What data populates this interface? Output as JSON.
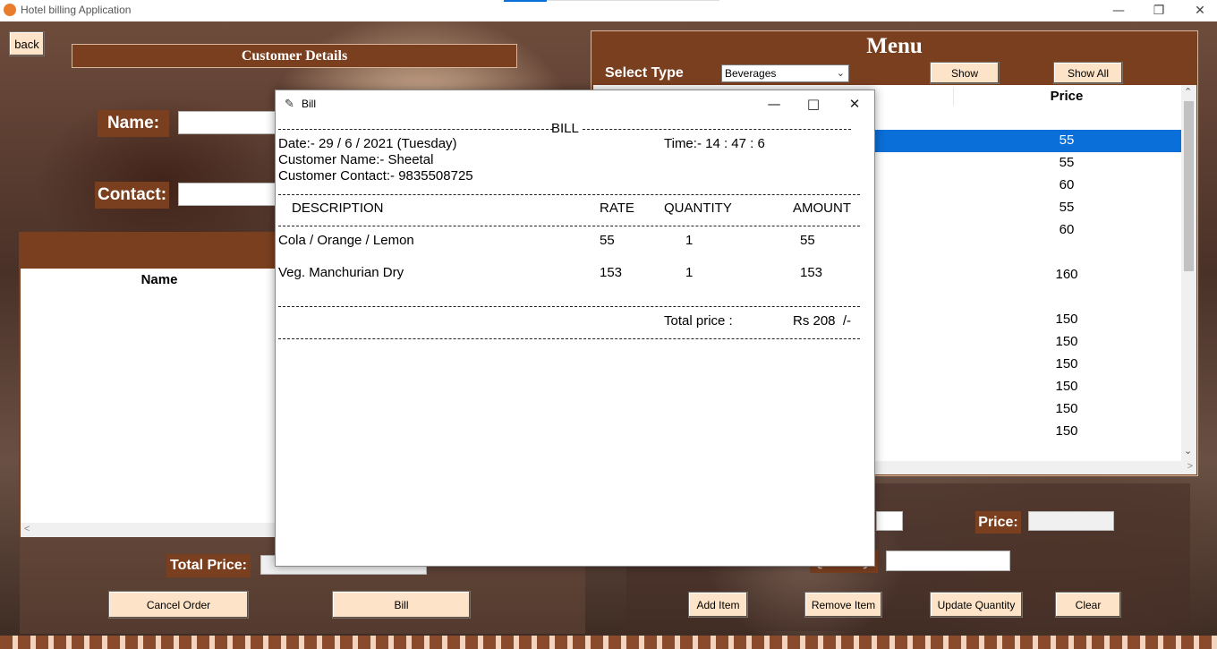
{
  "window": {
    "title": "Hotel billing Application",
    "minimize": "—",
    "restore": "❐",
    "close": "✕"
  },
  "left": {
    "back_label": "back",
    "customer_details_title": "Customer Details",
    "name_label": "Name:",
    "contact_label": "Contact:",
    "order_list_header": "Name",
    "total_price_label": "Total Price:",
    "cancel_label": "Cancel Order",
    "bill_label": "Bill"
  },
  "menu": {
    "title": "Menu",
    "select_type_label": "Select Type",
    "select_value": "Beverages",
    "show_label": "Show",
    "show_all_label": "Show All",
    "price_header": "Price",
    "prices": [
      "55",
      "55",
      "60",
      "55",
      "60",
      "160",
      "150",
      "150",
      "150",
      "150",
      "150",
      "150"
    ],
    "selected_index": 0
  },
  "item": {
    "price_label": "Price:",
    "quantity_label": "Quantity:",
    "add_label": "Add Item",
    "remove_label": "Remove Item",
    "update_label": "Update Quantity",
    "clear_label": "Clear"
  },
  "bill": {
    "title": "Bill",
    "heading": "BILL",
    "date": "Date:- 29 / 6 / 2021 (Tuesday)",
    "time": "Time:- 14 : 47 : 6",
    "customer_name": "Customer Name:- Sheetal",
    "customer_contact": "Customer Contact:- 9835508725",
    "columns": [
      "DESCRIPTION",
      "RATE",
      "QUANTITY",
      "AMOUNT"
    ],
    "rows": [
      {
        "description": "Cola / Orange / Lemon",
        "rate": "55",
        "quantity": "1",
        "amount": "55"
      },
      {
        "description": "Veg. Manchurian Dry",
        "rate": "153",
        "quantity": "1",
        "amount": "153"
      }
    ],
    "total_label": "Total price :",
    "total_value": "Rs 208  /-"
  }
}
